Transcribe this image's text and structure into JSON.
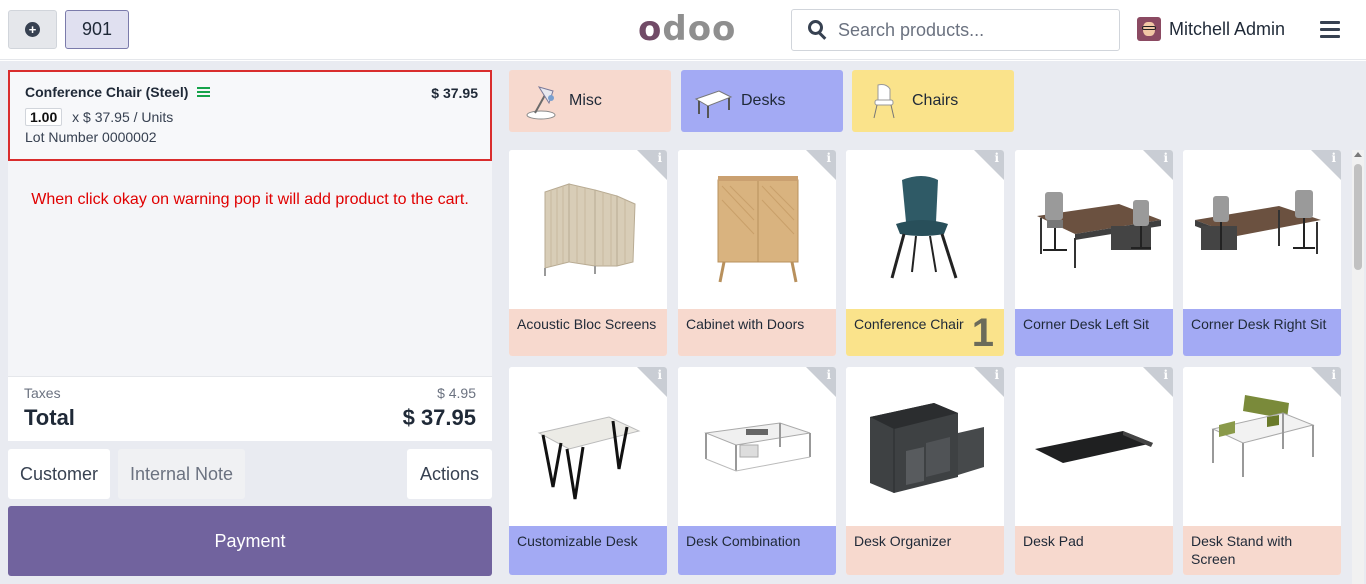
{
  "header": {
    "order_number": "901",
    "logo": "odoo",
    "search_placeholder": "Search products...",
    "user_name": "Mitchell Admin"
  },
  "orderline": {
    "product_name": "Conference Chair (Steel)",
    "price": "$ 37.95",
    "quantity": "1.00",
    "unit_price": "x $ 37.95 / Units",
    "lot": "Lot Number 0000002"
  },
  "note": "When click okay on warning pop it will add product to the cart.",
  "totals": {
    "taxes_label": "Taxes",
    "taxes_value": "$ 4.95",
    "total_label": "Total",
    "total_value": "$ 37.95"
  },
  "actions": {
    "customer": "Customer",
    "internal_note": "Internal Note",
    "actions": "Actions",
    "payment": "Payment"
  },
  "categories": [
    {
      "label": "Misc",
      "color": "#f7d9ce"
    },
    {
      "label": "Desks",
      "color": "#a3aaf4"
    },
    {
      "label": "Chairs",
      "color": "#fae38b"
    }
  ],
  "products": [
    {
      "name": "Acoustic Bloc Screens",
      "color": "#f7d9ce"
    },
    {
      "name": "Cabinet with Doors",
      "color": "#f7d9ce"
    },
    {
      "name": "Conference Chair",
      "color": "#fae38b",
      "qty": "1"
    },
    {
      "name": "Corner Desk Left Sit",
      "color": "#a3aaf4"
    },
    {
      "name": "Corner Desk Right Sit",
      "color": "#a3aaf4"
    },
    {
      "name": "Customizable Desk",
      "color": "#a3aaf4"
    },
    {
      "name": "Desk Combination",
      "color": "#a3aaf4"
    },
    {
      "name": "Desk Organizer",
      "color": "#f7d9ce"
    },
    {
      "name": "Desk Pad",
      "color": "#f7d9ce"
    },
    {
      "name": "Desk Stand with Screen",
      "color": "#f7d9ce"
    }
  ]
}
